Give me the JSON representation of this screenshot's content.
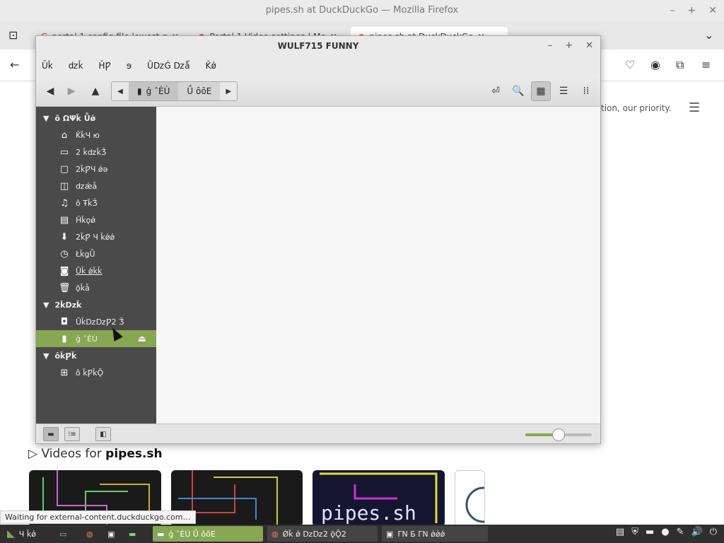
{
  "firefox": {
    "window_title": "pipes.sh at DuckDuckGo — Mozilla Firefox",
    "tabs": [
      {
        "label": "portal 1 config file lowest g"
      },
      {
        "label": "Portal 1 Video settings | Mo"
      },
      {
        "label": "pipes.sh at DuckDuckGo"
      }
    ],
    "privacy_text": "tion, our priority.",
    "videos_label": "Videos for",
    "videos_query": "pipes.sh",
    "thumb_text": "pipes.sh",
    "status_text": "Waiting for external-content.duckduckgo.com…"
  },
  "file_manager": {
    "title": "WULF715 FUNNY",
    "menu": [
      "Ȕǩ",
      "ǳǩ",
      "ȞǷ",
      "ɘ",
      "ȖǲǴ ǲǻ",
      "Ǩǿ"
    ],
    "path": [
      "ǵ ˆĖÙ",
      "Ǘ ôôE"
    ],
    "sidebar": {
      "sections": [
        {
          "label": "ô ΩΨǩ Ǖǿ",
          "items": [
            {
              "label": "ǨǩЧ ю",
              "icon": "home-icon"
            },
            {
              "label": "2 ǩǳǩǮ",
              "icon": "desktop-icon"
            },
            {
              "label": "2ǩǷЧ ǿǝ",
              "icon": "documents-icon"
            },
            {
              "label": "ǳǽǡ",
              "icon": "pictures-icon"
            },
            {
              "label": "ô ŦǩǮ",
              "icon": "music-icon"
            },
            {
              "label": "Ȟǩǫǿ",
              "icon": "videos-icon"
            },
            {
              "label": "2ǩǷ Ч ǩǿǿ",
              "icon": "downloads-icon"
            },
            {
              "label": "ŁǩǥǛ",
              "icon": "recent-icon"
            },
            {
              "label": "Ȕǩ ǿǩǩ",
              "icon": "filesystem-icon"
            },
            {
              "label": "ǭǩǡ",
              "icon": "trash-icon"
            }
          ]
        },
        {
          "label": "2ǩǲǩ",
          "items": [
            {
              "label": "ȖǩǲǲǷ2 Ǯ",
              "icon": "drive-icon"
            },
            {
              "label": "ǵ ˆĖÙ",
              "icon": "usb-icon",
              "selected": true
            }
          ]
        },
        {
          "label": "ôǩǷǩ",
          "items": [
            {
              "label": "ô ǩǷǩǬ",
              "icon": "network-icon"
            }
          ]
        }
      ]
    },
    "zoom_level": 0.5
  },
  "taskbar": {
    "menu_label": "Ч ǩǿ",
    "tasks": [
      {
        "label": "ǵ ˆĖÙ   Ǘ ôôE"
      },
      {
        "label": "Ǿǩ ǿ ǲǲ2 ǭǬ2"
      },
      {
        "label": "ΓΝ  Б ΓΝ  ǿǿǿ"
      }
    ]
  }
}
